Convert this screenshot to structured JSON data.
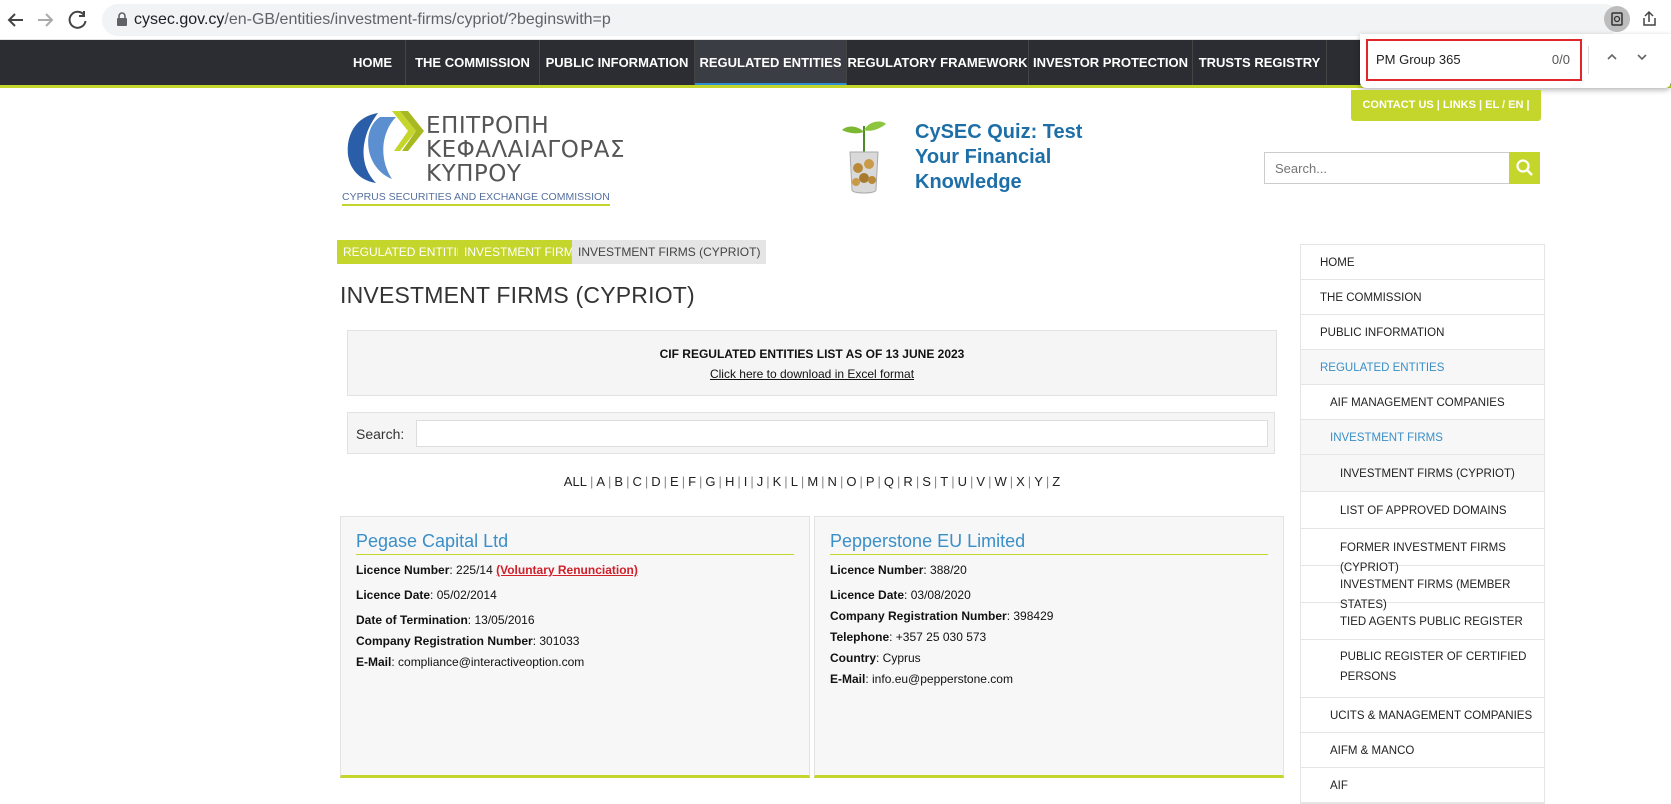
{
  "browser": {
    "url_host": "cysec.gov.cy",
    "url_path": "/en-GB/entities/investment-firms/cypriot/?beginswith=p"
  },
  "find_bar": {
    "query": "PM Group 365",
    "count": "0/0"
  },
  "topnav": [
    "HOME",
    "THE COMMISSION",
    "PUBLIC INFORMATION",
    "REGULATED ENTITIES",
    "REGULATORY FRAMEWORK",
    "INVESTOR PROTECTION",
    "TRUSTS REGISTRY"
  ],
  "utility_links": "CONTACT US  |  LINKS  |   EL / EN |",
  "logo": {
    "greek_lines": [
      "ΕΠΙΤΡΟΠΗ",
      "ΚΕΦΑΛΑΙΑΓΟΡΑΣ",
      "ΚΥΠΡΟΥ"
    ],
    "english": "CYPRUS SECURITIES AND EXCHANGE COMMISSION"
  },
  "quiz": {
    "lines": [
      "CySEC Quiz: Test",
      "Your Financial",
      "Knowledge"
    ]
  },
  "site_search": {
    "placeholder": "Search..."
  },
  "breadcrumb": [
    "REGULATED ENTITIES",
    "INVESTMENT FIRMS",
    "INVESTMENT FIRMS (CYPRIOT)"
  ],
  "page_title": "INVESTMENT FIRMS (CYPRIOT)",
  "notice": {
    "title": "CIF REGULATED ENTITIES LIST AS OF 13 JUNE 2023",
    "link": "Click here to download in Excel format"
  },
  "list_search": {
    "label": "Search:"
  },
  "alphabet": [
    "ALL",
    "A",
    "B",
    "C",
    "D",
    "E",
    "F",
    "G",
    "H",
    "I",
    "J",
    "K",
    "L",
    "M",
    "N",
    "O",
    "P",
    "Q",
    "R",
    "S",
    "T",
    "U",
    "V",
    "W",
    "X",
    "Y",
    "Z"
  ],
  "cards": [
    {
      "name": "Pegase Capital Ltd",
      "rows": [
        {
          "label": "Licence Number",
          "value": "225/14",
          "extra": "(Voluntary Renunciation)"
        },
        {
          "label": "Licence Date",
          "value": "05/02/2014"
        },
        {
          "label": "Date of Termination",
          "value": "13/05/2016"
        },
        {
          "label": "Company Registration Number",
          "value": "301033"
        },
        {
          "label": "E-Mail",
          "value": "compliance@interactiveoption.com"
        }
      ]
    },
    {
      "name": "Pepperstone EU Limited",
      "rows": [
        {
          "label": "Licence Number",
          "value": "388/20"
        },
        {
          "label": "Licence Date",
          "value": "03/08/2020"
        },
        {
          "label": "Company Registration Number",
          "value": "398429"
        },
        {
          "label": "Telephone",
          "value": "+357 25 030 573"
        },
        {
          "label": "Country",
          "value": "Cyprus"
        },
        {
          "label": "E-Mail",
          "value": "info.eu@pepperstone.com"
        }
      ]
    }
  ],
  "sidebar": [
    {
      "label": "HOME"
    },
    {
      "label": "THE COMMISSION"
    },
    {
      "label": "PUBLIC INFORMATION"
    },
    {
      "label": "REGULATED ENTITIES"
    },
    {
      "label": "AIF MANAGEMENT COMPANIES"
    },
    {
      "label": "INVESTMENT FIRMS"
    },
    {
      "label": "INVESTMENT FIRMS (CYPRIOT)"
    },
    {
      "label": "LIST OF APPROVED DOMAINS"
    },
    {
      "label": "FORMER INVESTMENT FIRMS (CYPRIOT)"
    },
    {
      "label": "INVESTMENT FIRMS (MEMBER STATES)"
    },
    {
      "label": "TIED AGENTS PUBLIC REGISTER"
    },
    {
      "label": "PUBLIC REGISTER OF CERTIFIED PERSONS"
    },
    {
      "label": "UCITS & MANAGEMENT COMPANIES"
    },
    {
      "label": "AIFM & MANCO"
    },
    {
      "label": "AIF"
    }
  ],
  "colors": {
    "accent_green": "#c4d62c",
    "link_blue": "#3a8fc8",
    "nav_dark": "#2b2d32",
    "find_border": "#e0262a"
  }
}
